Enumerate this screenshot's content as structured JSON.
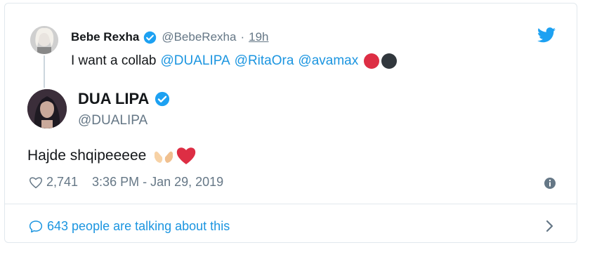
{
  "parent_tweet": {
    "name": "Bebe Rexha",
    "handle": "@BebeRexha",
    "separator": "·",
    "time": "19h",
    "text_prefix": "I want a collab",
    "mentions": [
      "@DUALIPA",
      "@RitaOra",
      "@avamax"
    ],
    "emoji_colors": [
      "#dd2e44",
      "#31373d"
    ]
  },
  "main_tweet": {
    "name": "DUA LIPA",
    "handle": "@DUALIPA",
    "text": "Hajde shqipeeeee",
    "emojis": [
      "palms-up-together-emoji",
      "red-heart-emoji"
    ],
    "likes": "2,741",
    "timestamp": "3:36 PM - Jan 29, 2019"
  },
  "footer": {
    "talking_text": "643 people are talking about this"
  },
  "colors": {
    "link": "#1b95e0",
    "muted": "#657786",
    "border": "#e1e8ed",
    "verified": "#1da1f2"
  }
}
